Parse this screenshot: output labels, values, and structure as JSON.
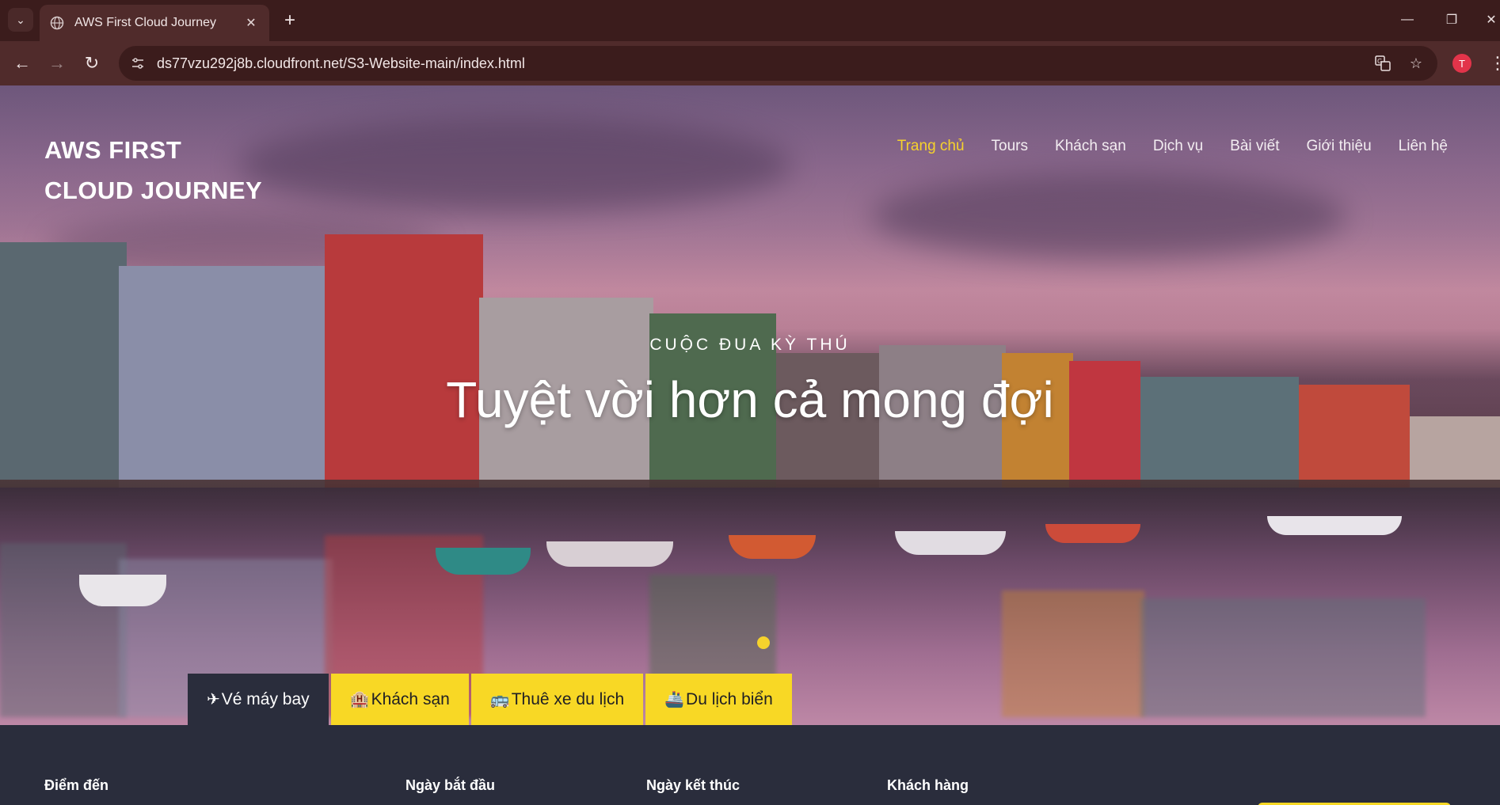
{
  "browser": {
    "tab_title": "AWS First Cloud Journey",
    "url": "ds77vzu292j8b.cloudfront.net/S3-Website-main/index.html",
    "profile_initial": "T"
  },
  "site": {
    "brand_line1": "AWS FIRST",
    "brand_line2": "CLOUD JOURNEY",
    "nav": [
      {
        "label": "Trang chủ"
      },
      {
        "label": "Tours"
      },
      {
        "label": "Khách sạn"
      },
      {
        "label": "Dịch vụ"
      },
      {
        "label": "Bài viết"
      },
      {
        "label": "Giới thiệu"
      },
      {
        "label": "Liên hệ"
      }
    ],
    "hero": {
      "eyebrow": "CUỘC ĐUA KỲ THÚ",
      "headline": "Tuyệt vời hơn cả mong đợi"
    },
    "booking_tabs": [
      {
        "label": "Vé máy bay",
        "icon": "airplane-icon"
      },
      {
        "label": "Khách sạn",
        "icon": "hotel-icon"
      },
      {
        "label": "Thuê xe du lịch",
        "icon": "bus-icon"
      },
      {
        "label": "Du lịch biển",
        "icon": "ship-icon"
      }
    ],
    "form_labels": {
      "destination": "Điểm đến",
      "start_date": "Ngày bắt đầu",
      "end_date": "Ngày kết thúc",
      "customers": "Khách hàng"
    }
  },
  "colors": {
    "accent": "#f6d22c",
    "dark_panel": "#2a2d3c",
    "chrome": "#3b1c1c"
  }
}
